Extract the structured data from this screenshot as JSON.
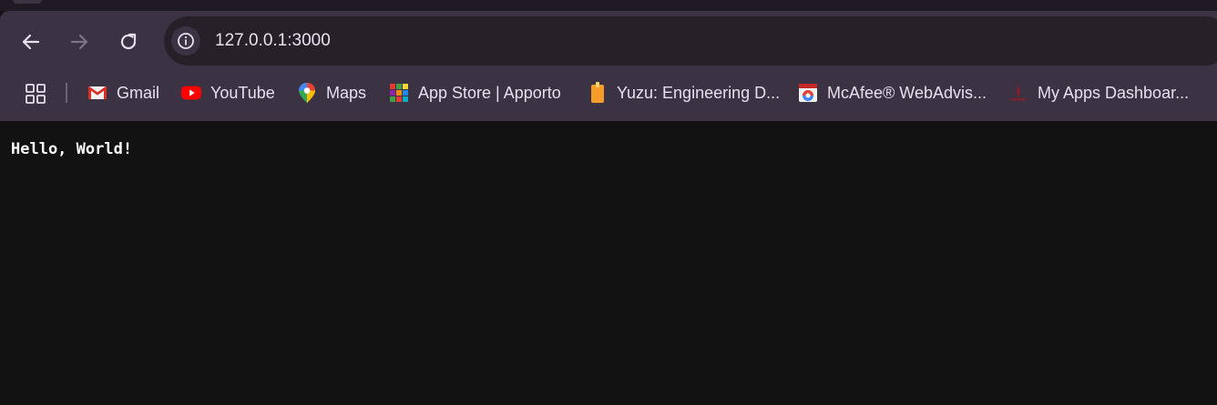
{
  "browser": {
    "address_bar": {
      "url": "127.0.0.1:3000"
    },
    "bookmarks": [
      {
        "label": "Gmail",
        "icon": "gmail-icon"
      },
      {
        "label": "YouTube",
        "icon": "youtube-icon"
      },
      {
        "label": "Maps",
        "icon": "maps-icon"
      },
      {
        "label": "App Store | Apporto",
        "icon": "apporto-icon"
      },
      {
        "label": "Yuzu: Engineering D...",
        "icon": "yuzu-icon"
      },
      {
        "label": "McAfee® WebAdvis...",
        "icon": "mcafee-icon"
      },
      {
        "label": "My Apps Dashboar...",
        "icon": "my-apps-icon"
      }
    ]
  },
  "page": {
    "text": "Hello, World!"
  },
  "colors": {
    "toolbar_bg": "#3b3344",
    "omnibox_bg": "#262029",
    "page_bg": "#121212",
    "text": "#e6e0ec"
  }
}
